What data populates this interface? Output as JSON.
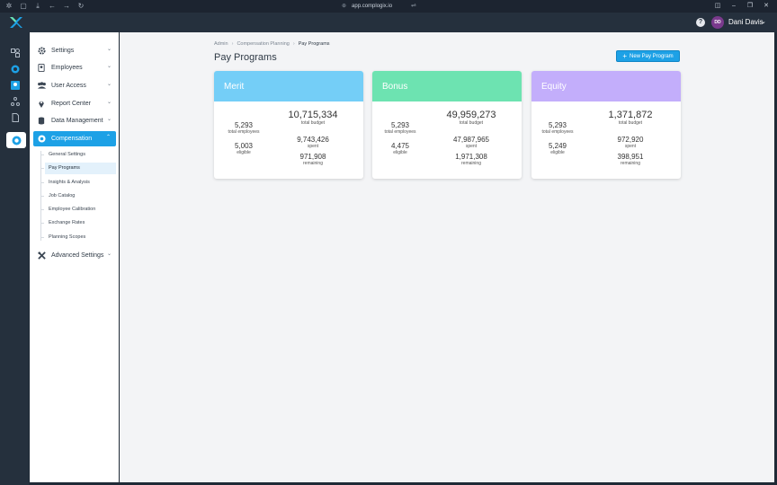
{
  "browser": {
    "url": "app.complogix.io"
  },
  "header": {
    "help_icon": "?",
    "avatar_initials": "DD",
    "user_name": "Dani Davis"
  },
  "sidebar": {
    "items": [
      {
        "label": "Settings",
        "icon": "gear-icon"
      },
      {
        "label": "Employees",
        "icon": "id-badge-icon"
      },
      {
        "label": "User Access",
        "icon": "users-icon"
      },
      {
        "label": "Report Center",
        "icon": "map-pin-icon"
      },
      {
        "label": "Data Management",
        "icon": "database-icon"
      },
      {
        "label": "Compensation",
        "icon": "coin-gear-icon"
      },
      {
        "label": "Advanced Settings",
        "icon": "tools-icon"
      }
    ],
    "sub_items": [
      "General Settings",
      "Pay Programs",
      "Insights & Analysis",
      "Job Catalog",
      "Employee Calibration",
      "Exchange Rates",
      "Planning Scopes"
    ]
  },
  "breadcrumb": [
    "Admin",
    "Compensation Planning",
    "Pay Programs"
  ],
  "page": {
    "title": "Pay Programs",
    "new_button": "New Pay Program"
  },
  "cards": [
    {
      "name": "Merit",
      "color": "#74cef7",
      "total_employees": "5,293",
      "total_employees_label": "total employees",
      "eligible": "5,003",
      "eligible_label": "eligible",
      "total_budget": "10,715,334",
      "total_budget_label": "total budget",
      "spent": "9,743,426",
      "spent_label": "spent",
      "remaining": "971,908",
      "remaining_label": "remaining"
    },
    {
      "name": "Bonus",
      "color": "#6de3b1",
      "total_employees": "5,293",
      "total_employees_label": "total employees",
      "eligible": "4,475",
      "eligible_label": "eligible",
      "total_budget": "49,959,273",
      "total_budget_label": "total budget",
      "spent": "47,987,965",
      "spent_label": "spent",
      "remaining": "1,971,308",
      "remaining_label": "remaining"
    },
    {
      "name": "Equity",
      "color": "#c3aefb",
      "total_employees": "5,293",
      "total_employees_label": "total employees",
      "eligible": "5,249",
      "eligible_label": "eligible",
      "total_budget": "1,371,872",
      "total_budget_label": "total budget",
      "spent": "972,920",
      "spent_label": "spent",
      "remaining": "398,951",
      "remaining_label": "remaining"
    }
  ]
}
